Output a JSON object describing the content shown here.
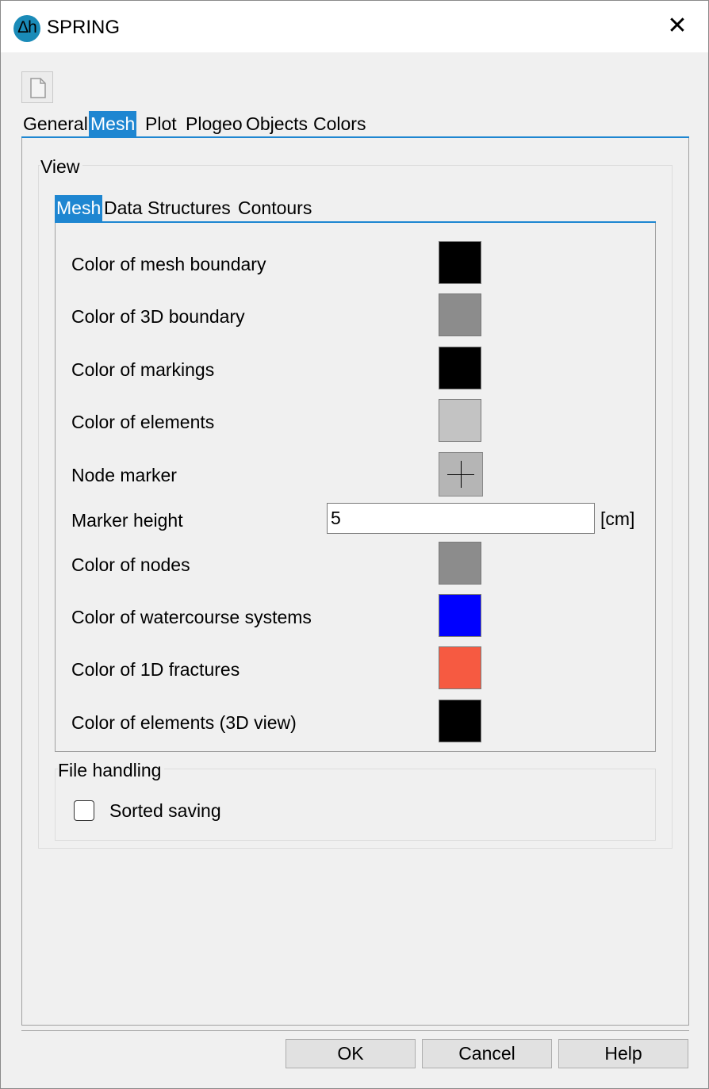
{
  "window": {
    "title": "SPRING",
    "logo_text": "Δh"
  },
  "tabs": [
    {
      "label": "General"
    },
    {
      "label": "Mesh"
    },
    {
      "label": "Plot"
    },
    {
      "label": "Plogeo"
    },
    {
      "label": "Objects"
    },
    {
      "label": "Colors"
    }
  ],
  "view": {
    "group_label": "View",
    "subtabs": [
      {
        "label": "Mesh"
      },
      {
        "label": "Data Structures"
      },
      {
        "label": "Contours"
      }
    ],
    "rows": {
      "mesh_boundary": {
        "label": "Color of mesh boundary",
        "color": "#000000"
      },
      "boundary_3d": {
        "label": "Color of 3D boundary",
        "color": "#8c8c8c"
      },
      "markings": {
        "label": "Color of markings",
        "color": "#000000"
      },
      "elements": {
        "label": "Color of elements",
        "color": "#c3c3c3"
      },
      "node_marker": {
        "label": "Node marker",
        "icon": "plus-icon"
      },
      "marker_height": {
        "label": "Marker height",
        "value": "5",
        "unit": "[cm]"
      },
      "nodes": {
        "label": "Color of nodes",
        "color": "#8c8c8c"
      },
      "watercourse": {
        "label": "Color of watercourse systems",
        "color": "#0000ff"
      },
      "fractures_1d": {
        "label": "Color of 1D fractures",
        "color": "#f65a41"
      },
      "elements_3d": {
        "label": "Color of elements (3D view)",
        "color": "#000000"
      }
    }
  },
  "file_handling": {
    "group_label": "File handling",
    "sorted_saving": {
      "label": "Sorted saving",
      "checked": false
    }
  },
  "buttons": {
    "ok": "OK",
    "cancel": "Cancel",
    "help": "Help"
  }
}
